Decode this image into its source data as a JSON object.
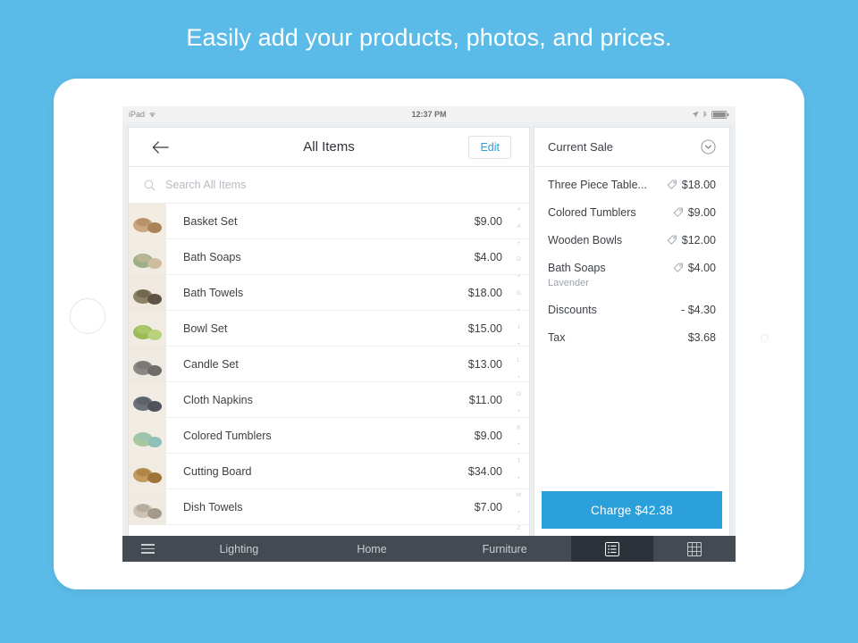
{
  "headline": "Easily add your products, photos, and prices.",
  "theme": {
    "background": "#5bbbe8",
    "accent": "#2b9fd9",
    "tabbar": "#434a52",
    "tabbar_selected": "#2c3239"
  },
  "status_bar": {
    "device_label": "iPad",
    "wifi_icon": "wifi-icon",
    "time": "12:37 PM",
    "location_icon": "location-arrow-icon",
    "bluetooth_icon": "bluetooth-icon",
    "battery_icon": "battery-icon"
  },
  "nav": {
    "back_icon": "back-arrow-icon",
    "title": "All Items",
    "edit_label": "Edit"
  },
  "search": {
    "icon": "search-icon",
    "placeholder": "Search All Items",
    "value": ""
  },
  "items": [
    {
      "name": "Basket Set",
      "price": "$9.00",
      "thumb": "basket-set-thumbnail"
    },
    {
      "name": "Bath Soaps",
      "price": "$4.00",
      "thumb": "bath-soaps-thumbnail"
    },
    {
      "name": "Bath Towels",
      "price": "$18.00",
      "thumb": "bath-towels-thumbnail"
    },
    {
      "name": "Bowl Set",
      "price": "$15.00",
      "thumb": "bowl-set-thumbnail"
    },
    {
      "name": "Candle Set",
      "price": "$13.00",
      "thumb": "candle-set-thumbnail"
    },
    {
      "name": "Cloth Napkins",
      "price": "$11.00",
      "thumb": "cloth-napkins-thumbnail"
    },
    {
      "name": "Colored Tumblers",
      "price": "$9.00",
      "thumb": "colored-tumblers-thumbnail"
    },
    {
      "name": "Cutting Board",
      "price": "$34.00",
      "thumb": "cutting-board-thumbnail"
    },
    {
      "name": "Dish Towels",
      "price": "$7.00",
      "thumb": "dish-towels-thumbnail"
    }
  ],
  "alpha_index": [
    "#",
    "A",
    "•",
    "D",
    "•",
    "G",
    "•",
    "I",
    "•",
    "L",
    "•",
    "O",
    "•",
    "R",
    "•",
    "T",
    "•",
    "W",
    "•",
    "Z"
  ],
  "cart": {
    "title": "Current Sale",
    "collapse_icon": "chevron-down-circle-icon",
    "lines": [
      {
        "name": "Three Piece Table...",
        "sub": "",
        "amount": "$18.00",
        "tag": true
      },
      {
        "name": "Colored Tumblers",
        "sub": "",
        "amount": "$9.00",
        "tag": true
      },
      {
        "name": "Wooden Bowls",
        "sub": "",
        "amount": "$12.00",
        "tag": true
      },
      {
        "name": "Bath Soaps",
        "sub": "Lavender",
        "amount": "$4.00",
        "tag": true
      },
      {
        "name": "Discounts",
        "sub": "",
        "amount": "- $4.30",
        "tag": false
      },
      {
        "name": "Tax",
        "sub": "",
        "amount": "$3.68",
        "tag": false
      }
    ],
    "charge_label": "Charge $42.38"
  },
  "tabbar": {
    "menu_icon": "hamburger-menu-icon",
    "categories": [
      "Lighting",
      "Home",
      "Furniture"
    ],
    "list_view_icon": "list-view-icon",
    "grid_view_icon": "grid-view-icon"
  }
}
